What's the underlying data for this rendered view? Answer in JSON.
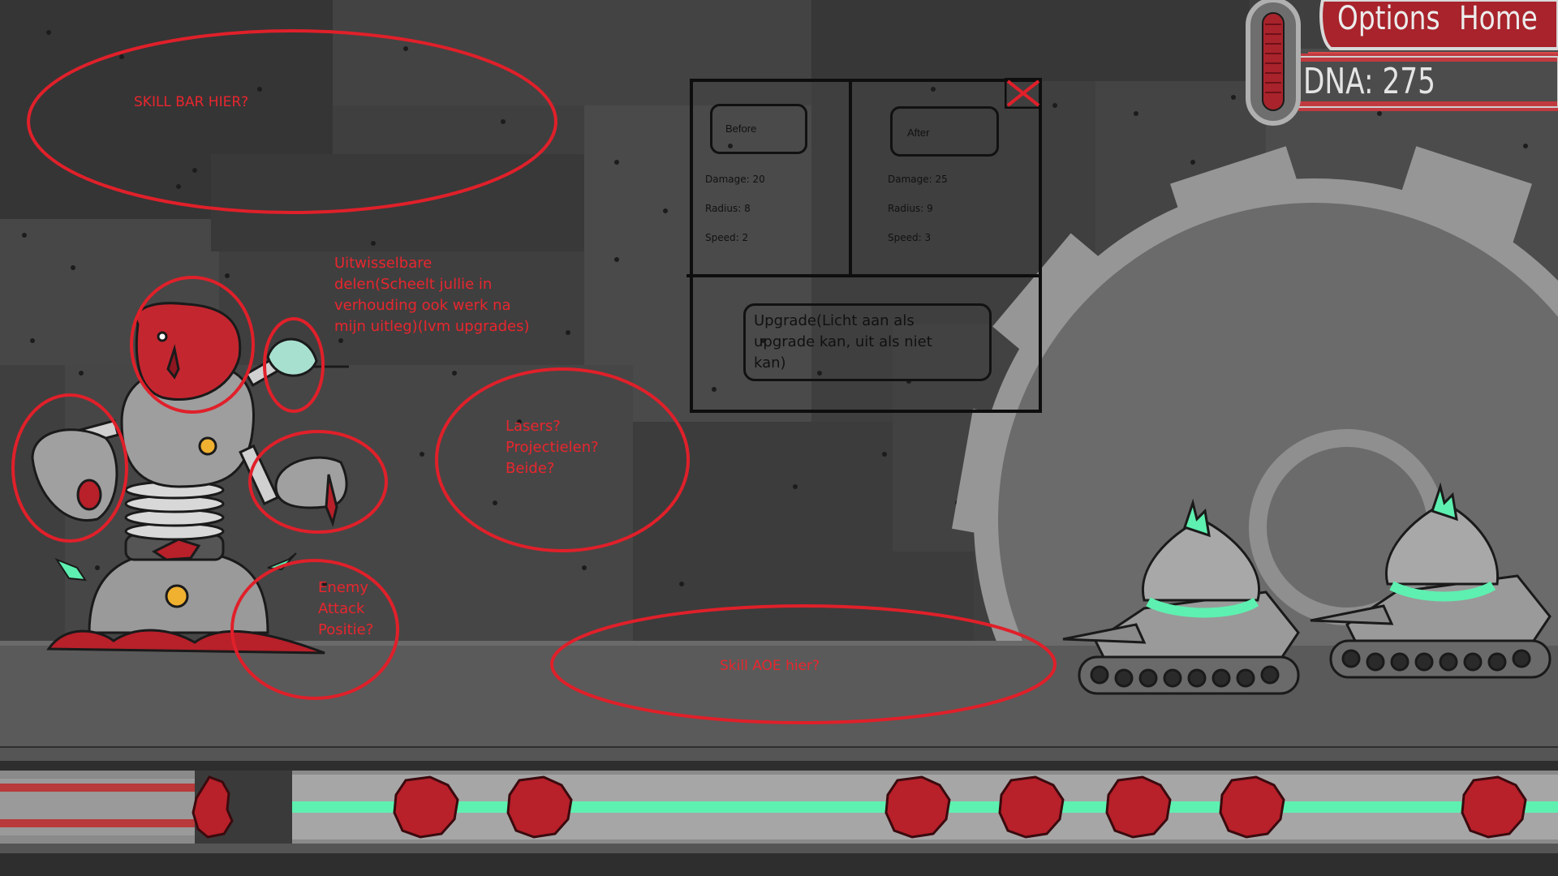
{
  "hud": {
    "options_label": "Options",
    "home_label": "Home",
    "dna_label": "DNA: 275",
    "dna_value": 275
  },
  "upgrade_panel": {
    "before": {
      "tab_label": "Before",
      "damage": "Damage: 20",
      "radius": "Radius: 8",
      "speed": "Speed: 2"
    },
    "after": {
      "tab_label": "After",
      "damage": "Damage: 25",
      "radius": "Radius: 9",
      "speed": "Speed: 3"
    },
    "upgrade_label": "Upgrade(Licht aan als upgrade kan, uit als niet kan)"
  },
  "notes": {
    "skill_bar": "SKILL BAR HIER?",
    "parts": "Uitwisselbare\ndelen(Scheelt jullie in\nverhouding ook werk na\nmijn uitleg)(Ivm upgrades)",
    "lasers": "Lasers?\nProjectielen?\nBeide?",
    "enemy_attack": "Enemy\nAttack\nPositie?",
    "skill_aoe": "Skill AOE hier?"
  },
  "colors": {
    "annotation_red": "#e8262e",
    "blob_red": "#b8202a",
    "accent_green": "#5ef0b0",
    "hud_red": "#a8232b",
    "metal_gray": "#a8a8a8"
  },
  "conveyor": {
    "blob_count": 9
  },
  "enemies": {
    "tank_count": 2
  }
}
